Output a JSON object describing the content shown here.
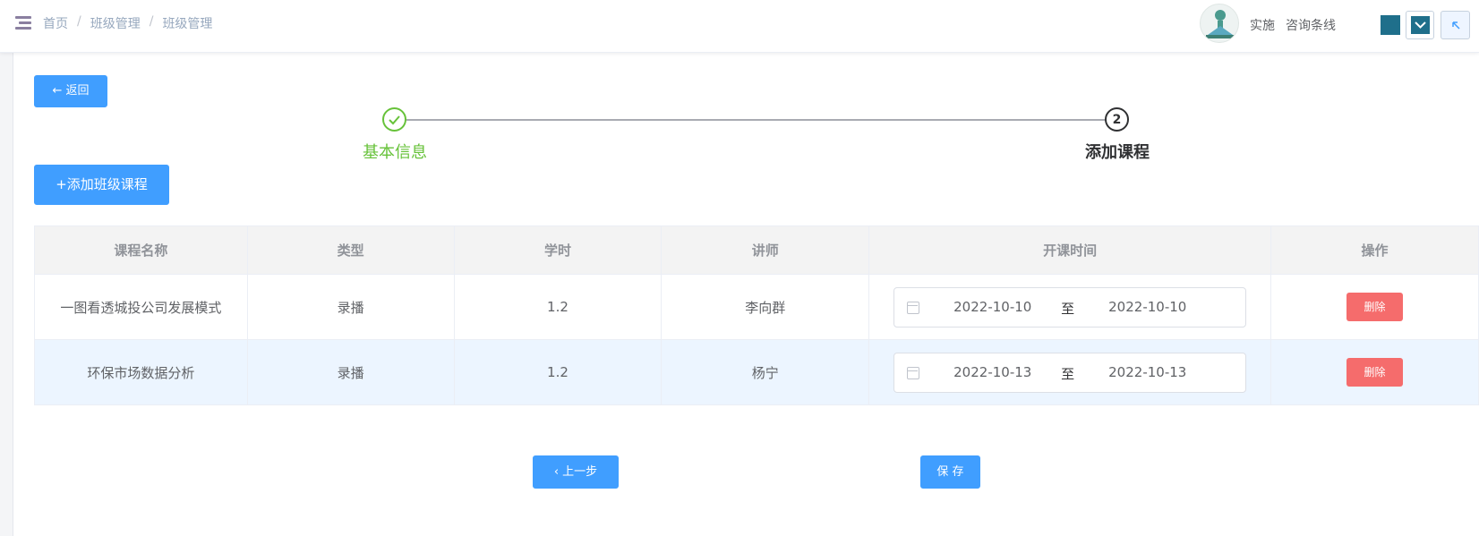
{
  "header": {
    "breadcrumb": [
      "首页",
      "班级管理",
      "班级管理"
    ],
    "breadcrumb_sep": "/",
    "user_name": "实施",
    "hotline": "咨询条线"
  },
  "page": {
    "back_label": "返回",
    "back_arrow": "←",
    "add_course_label": "+添加班级课程",
    "prev_label": "上一步",
    "prev_arrow": "‹",
    "save_label": "保 存"
  },
  "steps": [
    {
      "title": "基本信息",
      "status": "finished",
      "icon": "check-icon"
    },
    {
      "title": "添加课程",
      "status": "process",
      "index": "2"
    }
  ],
  "table": {
    "headers": [
      "课程名称",
      "类型",
      "学时",
      "讲师",
      "开课时间",
      "操作"
    ],
    "rows": [
      {
        "name": "一图看透城投公司发展模式",
        "type": "录播",
        "hours": "1.2",
        "teacher": "李向群",
        "start": "2022-10-10",
        "to": "至",
        "end": "2022-10-10",
        "action": "删除"
      },
      {
        "name": "环保市场数据分析",
        "type": "录播",
        "hours": "1.2",
        "teacher": "杨宁",
        "start": "2022-10-13",
        "to": "至",
        "end": "2022-10-13",
        "action": "删除"
      }
    ]
  },
  "colors": {
    "primary": "#409eff",
    "success": "#67c23a",
    "danger": "#f56c6c",
    "accent_square": "#1f6f8b"
  }
}
